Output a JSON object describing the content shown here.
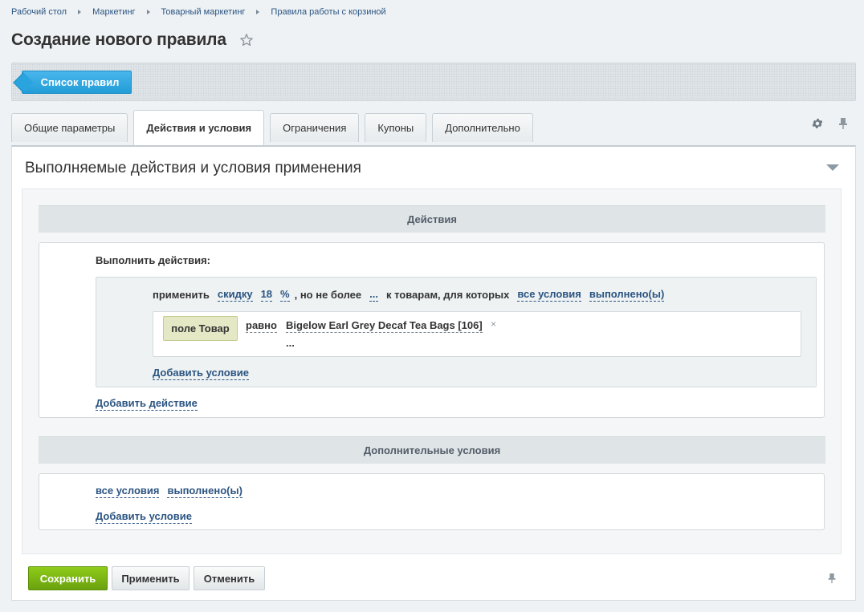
{
  "breadcrumbs": [
    "Рабочий стол",
    "Маркетинг",
    "Товарный маркетинг",
    "Правила работы с корзиной"
  ],
  "page_title": "Создание нового правила",
  "toolbar": {
    "list_button": "Список правил"
  },
  "tabs": [
    {
      "label": "Общие параметры",
      "active": false
    },
    {
      "label": "Действия и условия",
      "active": true
    },
    {
      "label": "Ограничения",
      "active": false
    },
    {
      "label": "Купоны",
      "active": false
    },
    {
      "label": "Дополнительно",
      "active": false
    }
  ],
  "section": {
    "title": "Выполняемые действия и условия применения",
    "actions_header": "Действия",
    "execute_actions_label": "Выполнить действия:",
    "action": {
      "apply": "применить",
      "discount": "скидку",
      "amount": "18",
      "unit": "%",
      "no_more_than": ", но не более",
      "limit": "...",
      "for_goods": "к товарам, для которых",
      "all_conditions": "все условия",
      "fulfilled": "выполнено(ы)"
    },
    "condition": {
      "field": "поле Товар",
      "operator": "равно",
      "value": "Bigelow Earl Grey Decaf Tea Bags [106]",
      "remove": "×",
      "more": "..."
    },
    "add_condition": "Добавить условие",
    "add_action": "Добавить действие",
    "extra_header": "Дополнительные условия",
    "extra": {
      "all_conditions": "все условия",
      "fulfilled": "выполнено(ы)",
      "add_condition": "Добавить условие"
    }
  },
  "buttons": {
    "save": "Сохранить",
    "apply": "Применить",
    "cancel": "Отменить"
  },
  "colors": {
    "accent_blue": "#229dd8",
    "save_green": "#6aa10e",
    "link": "#2b5482"
  }
}
